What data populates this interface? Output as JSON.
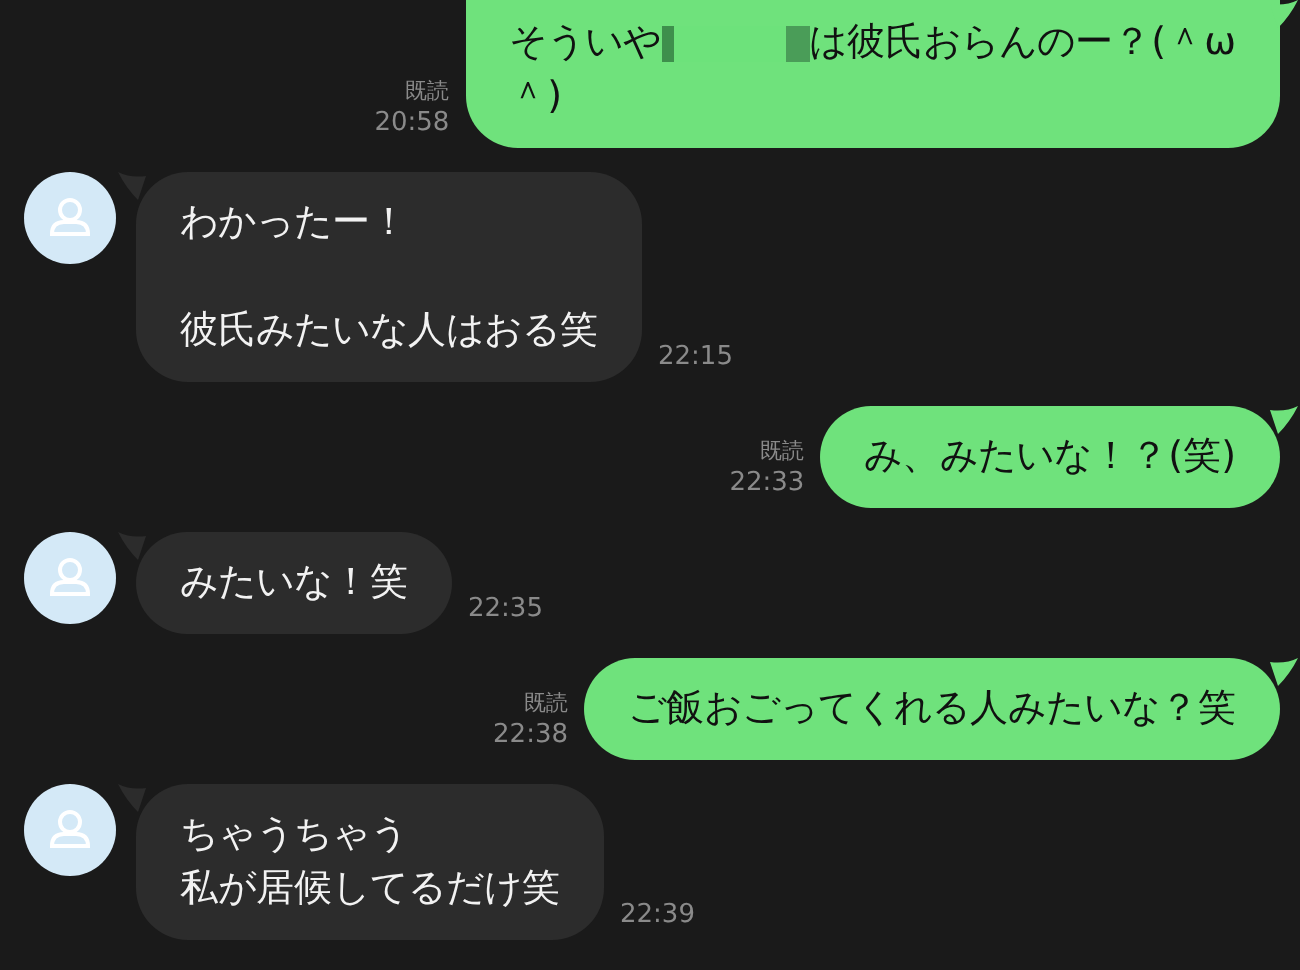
{
  "messages": [
    {
      "kind": "outgoing",
      "read": "既読",
      "time": "20:58",
      "paragraphs": [
        {
          "lines": [
            [
              {
                "kind": "text",
                "text": "そういや"
              },
              {
                "kind": "redaction"
              },
              {
                "kind": "text",
                "text": "は彼氏おらんのー？(＾ω"
              }
            ],
            [
              {
                "kind": "text",
                "text": "＾)"
              }
            ]
          ]
        }
      ]
    },
    {
      "kind": "incoming",
      "time": "22:15",
      "paragraphs": [
        {
          "lines": [
            [
              {
                "kind": "text",
                "text": "わかったー！"
              }
            ]
          ]
        },
        {
          "lines": [
            [
              {
                "kind": "text",
                "text": "彼氏みたいな人はおる笑"
              }
            ]
          ]
        }
      ]
    },
    {
      "kind": "outgoing",
      "read": "既読",
      "time": "22:33",
      "paragraphs": [
        {
          "lines": [
            [
              {
                "kind": "text",
                "text": "み、みたいな！？(笑)"
              }
            ]
          ]
        }
      ]
    },
    {
      "kind": "incoming",
      "time": "22:35",
      "paragraphs": [
        {
          "lines": [
            [
              {
                "kind": "text",
                "text": "みたいな！笑"
              }
            ]
          ]
        }
      ]
    },
    {
      "kind": "outgoing",
      "read": "既読",
      "time": "22:38",
      "paragraphs": [
        {
          "lines": [
            [
              {
                "kind": "text",
                "text": "ご飯おごってくれる人みたいな？笑"
              }
            ]
          ]
        }
      ]
    },
    {
      "kind": "incoming",
      "time": "22:39",
      "paragraphs": [
        {
          "lines": [
            [
              {
                "kind": "text",
                "text": "ちゃうちゃう"
              }
            ],
            [
              {
                "kind": "text",
                "text": "私が居候してるだけ笑"
              }
            ]
          ]
        }
      ]
    }
  ]
}
